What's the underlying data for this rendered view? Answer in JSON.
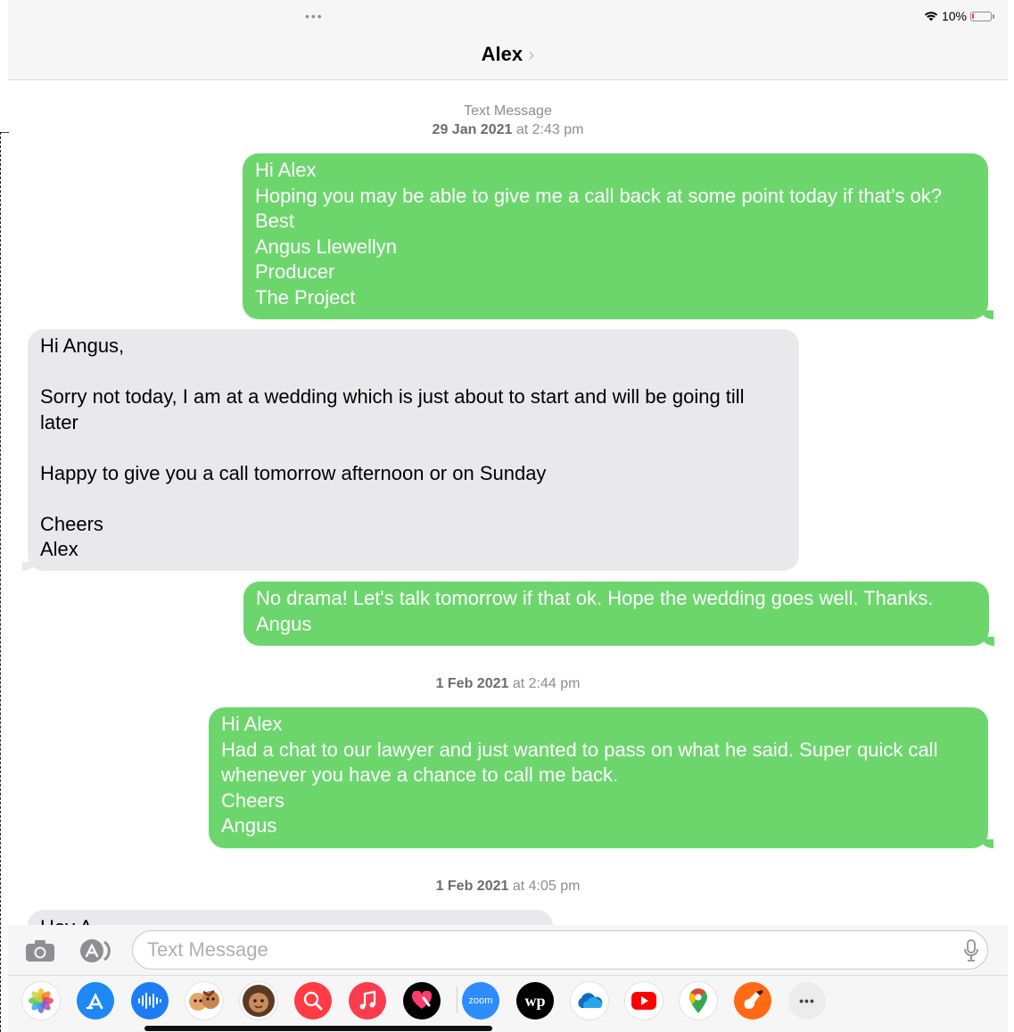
{
  "status_bar": {
    "battery_text": "10%",
    "battery_level": 0.1,
    "battery_color": "#ff3b30"
  },
  "header": {
    "contact_name": "Alex",
    "chevron": "›"
  },
  "thread": {
    "stamp1": {
      "label": "Text Message",
      "date": "29 Jan 2021",
      "time": " at 2:43 pm"
    },
    "msg1": "Hi Alex\nHoping you may be able to give me a call back at some point today if that’s ok?\nBest\nAngus Llewellyn\nProducer\nThe Project",
    "msg2": "Hi Angus,\n\nSorry not today, I am at a wedding which is just about to start and will be going till later\n\nHappy to give you a call tomorrow afternoon or on Sunday\n\nCheers\nAlex",
    "msg3": "No drama! Let's talk tomorrow if that ok. Hope the wedding goes well. Thanks. Angus",
    "stamp2": {
      "date": "1 Feb 2021",
      "time": " at 2:44 pm"
    },
    "msg4": "Hi Alex\nHad a chat to our lawyer and just wanted to pass on what he said. Super quick call whenever you have a chance to call me back.\nCheers\nAngus",
    "stamp3": {
      "date": "1 Feb 2021",
      "time": " at 4:05 pm"
    },
    "msg5_partial": "Hey A"
  },
  "composer": {
    "placeholder": "Text Message"
  },
  "app_drawer": [
    {
      "name": "photos",
      "color": "#ffffff"
    },
    {
      "name": "app-store",
      "color": "#1e88f5"
    },
    {
      "name": "audio-message",
      "color": "#1e7cf5"
    },
    {
      "name": "memoji-stickers",
      "color": "#ffffff"
    },
    {
      "name": "animoji",
      "color": "#ffffff"
    },
    {
      "name": "images-search",
      "color": "#ff3b44"
    },
    {
      "name": "music",
      "color": "#fb3c4f"
    },
    {
      "name": "digital-touch",
      "color": "#000000"
    },
    {
      "name": "zoom",
      "color": "#2d8cff",
      "label": "zoom"
    },
    {
      "name": "washington-post",
      "color": "#000000",
      "label": "wp"
    },
    {
      "name": "onedrive",
      "color": "#ffffff"
    },
    {
      "name": "youtube",
      "color": "#ffffff"
    },
    {
      "name": "google-maps",
      "color": "#ffffff"
    },
    {
      "name": "garageband",
      "color": "#ff6a13"
    },
    {
      "name": "more",
      "color": "#ececec",
      "label": "•••"
    }
  ]
}
